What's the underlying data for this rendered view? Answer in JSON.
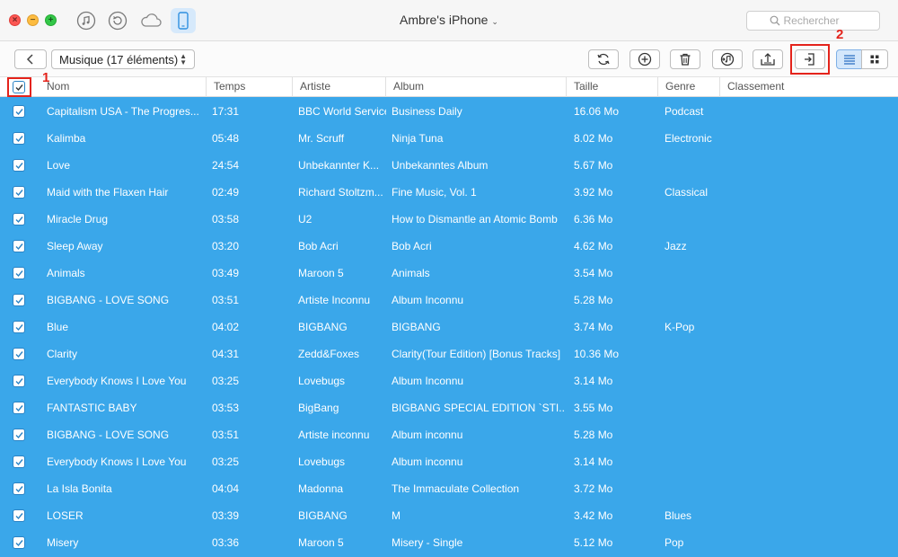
{
  "window": {
    "title": "Ambre's iPhone",
    "search_placeholder": "Rechercher"
  },
  "source_buttons": [
    "music-note-icon",
    "restore-icon",
    "cloud-icon",
    "iphone-icon"
  ],
  "toolbar": {
    "category_select": "Musique (17 éléments)",
    "actions": [
      "refresh-icon",
      "add-icon",
      "delete-icon",
      "to-itunes-icon",
      "to-computer-icon",
      "to-device-icon"
    ],
    "view_modes": [
      "list-view-icon",
      "grid-view-icon"
    ]
  },
  "annotations": {
    "step1": "1",
    "step2": "2"
  },
  "table": {
    "columns": [
      "Nom",
      "Temps",
      "Artiste",
      "Album",
      "Taille",
      "Genre",
      "Classement"
    ],
    "rows": [
      {
        "name": "Capitalism USA - The Progres...",
        "time": "17:31",
        "artist": "BBC World Service",
        "album": "Business Daily",
        "size": "16.06 Mo",
        "genre": "Podcast",
        "rating": ""
      },
      {
        "name": "Kalimba",
        "time": "05:48",
        "artist": "Mr. Scruff",
        "album": "Ninja Tuna",
        "size": "8.02 Mo",
        "genre": "Electronic",
        "rating": ""
      },
      {
        "name": "Love",
        "time": "24:54",
        "artist": "Unbekannter K...",
        "album": "Unbekanntes Album",
        "size": "5.67 Mo",
        "genre": "",
        "rating": ""
      },
      {
        "name": "Maid with the Flaxen Hair",
        "time": "02:49",
        "artist": "Richard Stoltzm...",
        "album": "Fine Music, Vol. 1",
        "size": "3.92 Mo",
        "genre": "Classical",
        "rating": ""
      },
      {
        "name": "Miracle Drug",
        "time": "03:58",
        "artist": "U2",
        "album": "How to Dismantle an Atomic Bomb",
        "size": "6.36 Mo",
        "genre": "",
        "rating": ""
      },
      {
        "name": "Sleep Away",
        "time": "03:20",
        "artist": "Bob Acri",
        "album": "Bob Acri",
        "size": "4.62 Mo",
        "genre": "Jazz",
        "rating": ""
      },
      {
        "name": "Animals",
        "time": "03:49",
        "artist": "Maroon 5",
        "album": "Animals",
        "size": "3.54 Mo",
        "genre": "",
        "rating": ""
      },
      {
        "name": "BIGBANG - LOVE SONG",
        "time": "03:51",
        "artist": "Artiste Inconnu",
        "album": "Album Inconnu",
        "size": "5.28 Mo",
        "genre": "",
        "rating": ""
      },
      {
        "name": "Blue",
        "time": "04:02",
        "artist": "BIGBANG",
        "album": "BIGBANG",
        "size": "3.74 Mo",
        "genre": "K-Pop",
        "rating": ""
      },
      {
        "name": "Clarity",
        "time": "04:31",
        "artist": "Zedd&Foxes",
        "album": "Clarity(Tour Edition) [Bonus Tracks]",
        "size": "10.36 Mo",
        "genre": "",
        "rating": ""
      },
      {
        "name": "Everybody Knows I Love You",
        "time": "03:25",
        "artist": "Lovebugs",
        "album": "Album Inconnu",
        "size": "3.14 Mo",
        "genre": "",
        "rating": ""
      },
      {
        "name": "FANTASTIC BABY",
        "time": "03:53",
        "artist": "BigBang",
        "album": "BIGBANG SPECIAL EDITION `STI...",
        "size": "3.55 Mo",
        "genre": "",
        "rating": ""
      },
      {
        "name": "BIGBANG - LOVE SONG",
        "time": "03:51",
        "artist": "Artiste inconnu",
        "album": "Album inconnu",
        "size": "5.28 Mo",
        "genre": "",
        "rating": ""
      },
      {
        "name": "Everybody Knows I Love You",
        "time": "03:25",
        "artist": "Lovebugs",
        "album": "Album inconnu",
        "size": "3.14 Mo",
        "genre": "",
        "rating": ""
      },
      {
        "name": "La Isla Bonita",
        "time": "04:04",
        "artist": "Madonna",
        "album": "The Immaculate Collection",
        "size": "3.72 Mo",
        "genre": "",
        "rating": ""
      },
      {
        "name": "LOSER",
        "time": "03:39",
        "artist": "BIGBANG",
        "album": "M",
        "size": "3.42 Mo",
        "genre": "Blues",
        "rating": ""
      },
      {
        "name": "Misery",
        "time": "03:36",
        "artist": "Maroon 5",
        "album": "Misery - Single",
        "size": "5.12 Mo",
        "genre": "Pop",
        "rating": ""
      }
    ]
  },
  "colors": {
    "selection": "#3aa7ea",
    "annotation": "#e4231b",
    "accent": "#2f8fe0"
  }
}
